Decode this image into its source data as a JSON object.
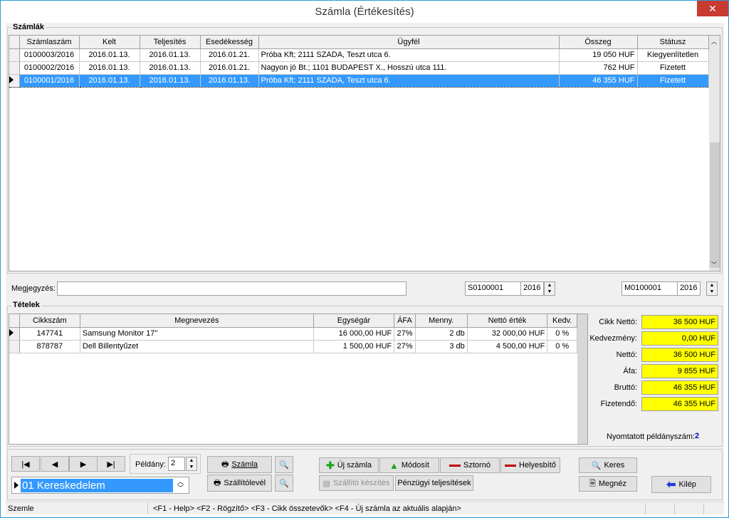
{
  "window": {
    "title": "Számla (Értékesítés)",
    "close": "✕"
  },
  "szamlak": {
    "title": "Számlák",
    "columns": [
      "Számlaszám",
      "Kelt",
      "Teljesítés",
      "Esedékesség",
      "Ügyfél",
      "Összeg",
      "Státusz"
    ],
    "rows": [
      [
        "0100003/2016",
        "2016.01.13.",
        "2016.01.13.",
        "2016.01.21.",
        "Próba Kft;  2111 SZADA, Teszt utca 6.",
        "19 050 HUF",
        "Kiegyenlítetlen"
      ],
      [
        "0100002/2016",
        "2016.01.13.",
        "2016.01.13.",
        "2016.01.21.",
        "Nagyon jó Bt.;  1101 BUDAPEST X., Hosszú utca 111.",
        "762 HUF",
        "Fizetett"
      ],
      [
        "0100001/2016",
        "2016.01.13.",
        "2016.01.13.",
        "2016.01.13.",
        "Próba Kft;  2111 SZADA, Teszt utca 6.",
        "46 355 HUF",
        "Fizetett"
      ]
    ],
    "selected_row": 2
  },
  "megjegyzes": {
    "label": "Megjegyzés:",
    "value": ""
  },
  "szallito": {
    "number": "S0100001",
    "year": "2016"
  },
  "penzugy": {
    "number": "M0100001",
    "year": "2016"
  },
  "tetelek": {
    "title": "Tételek",
    "columns": [
      "Cikkszám",
      "Megnevezés",
      "Egységár",
      "ÁFA",
      "Menny.",
      "Nettó érték",
      "Kedv."
    ],
    "rows": [
      [
        "147741",
        "Samsung Monitor 17''",
        "16 000,00 HUF",
        "27%",
        "2  db",
        "32 000,00 HUF",
        "0 %"
      ],
      [
        "878787",
        "Dell Billentyűzet",
        "1 500,00 HUF",
        "27%",
        "3  db",
        "4 500,00 HUF",
        "0 %"
      ]
    ]
  },
  "totals": {
    "cikk_netto": {
      "label": "Cikk Nettó:",
      "value": "36 500 HUF"
    },
    "kedvezmeny": {
      "label": "Kedvezmény:",
      "value": "0,00 HUF"
    },
    "netto": {
      "label": "Nettó:",
      "value": "36 500 HUF"
    },
    "afa": {
      "label": "Áfa:",
      "value": "9 855 HUF"
    },
    "brutto": {
      "label": "Bruttó:",
      "value": "46 355 HUF"
    },
    "fizetendo": {
      "label": "Fizetendő:",
      "value": "46 355 HUF"
    },
    "nyomtatott_label": "Nyomtatott példányszám:",
    "nyomtatott_value": "2"
  },
  "nav": {
    "first": "|◀",
    "prev": "◀",
    "next": "▶",
    "last": "▶|"
  },
  "peldany": {
    "label": "Példány:",
    "value": "2"
  },
  "buttons": {
    "szamla": "Számla",
    "szallitolevel": "Szállítólevél",
    "uj_szamla": "Új számla",
    "modosit": "Módosít",
    "sztorno": "Sztornó",
    "helyesbito": "Helyesbítő",
    "szallito_keszites": "Szállító készítés",
    "penzugyi": "Pénzügyi teljesítések",
    "keres": "Keres",
    "megnez": "Megnéz",
    "kilep": "Kilép"
  },
  "company": {
    "value": "01 Kereskedelem"
  },
  "statusbar": {
    "mode": "Szemle",
    "keys": "<F1 - Help>   <F2 - Rögzítő>   <F3 - Cikk összetevők>   <F4 - Új számla az aktuális alapján>"
  },
  "colors": {
    "selection": "#3399ff",
    "highlight": "#ffff00",
    "close": "#c73b32",
    "accent": "#0000cc"
  }
}
